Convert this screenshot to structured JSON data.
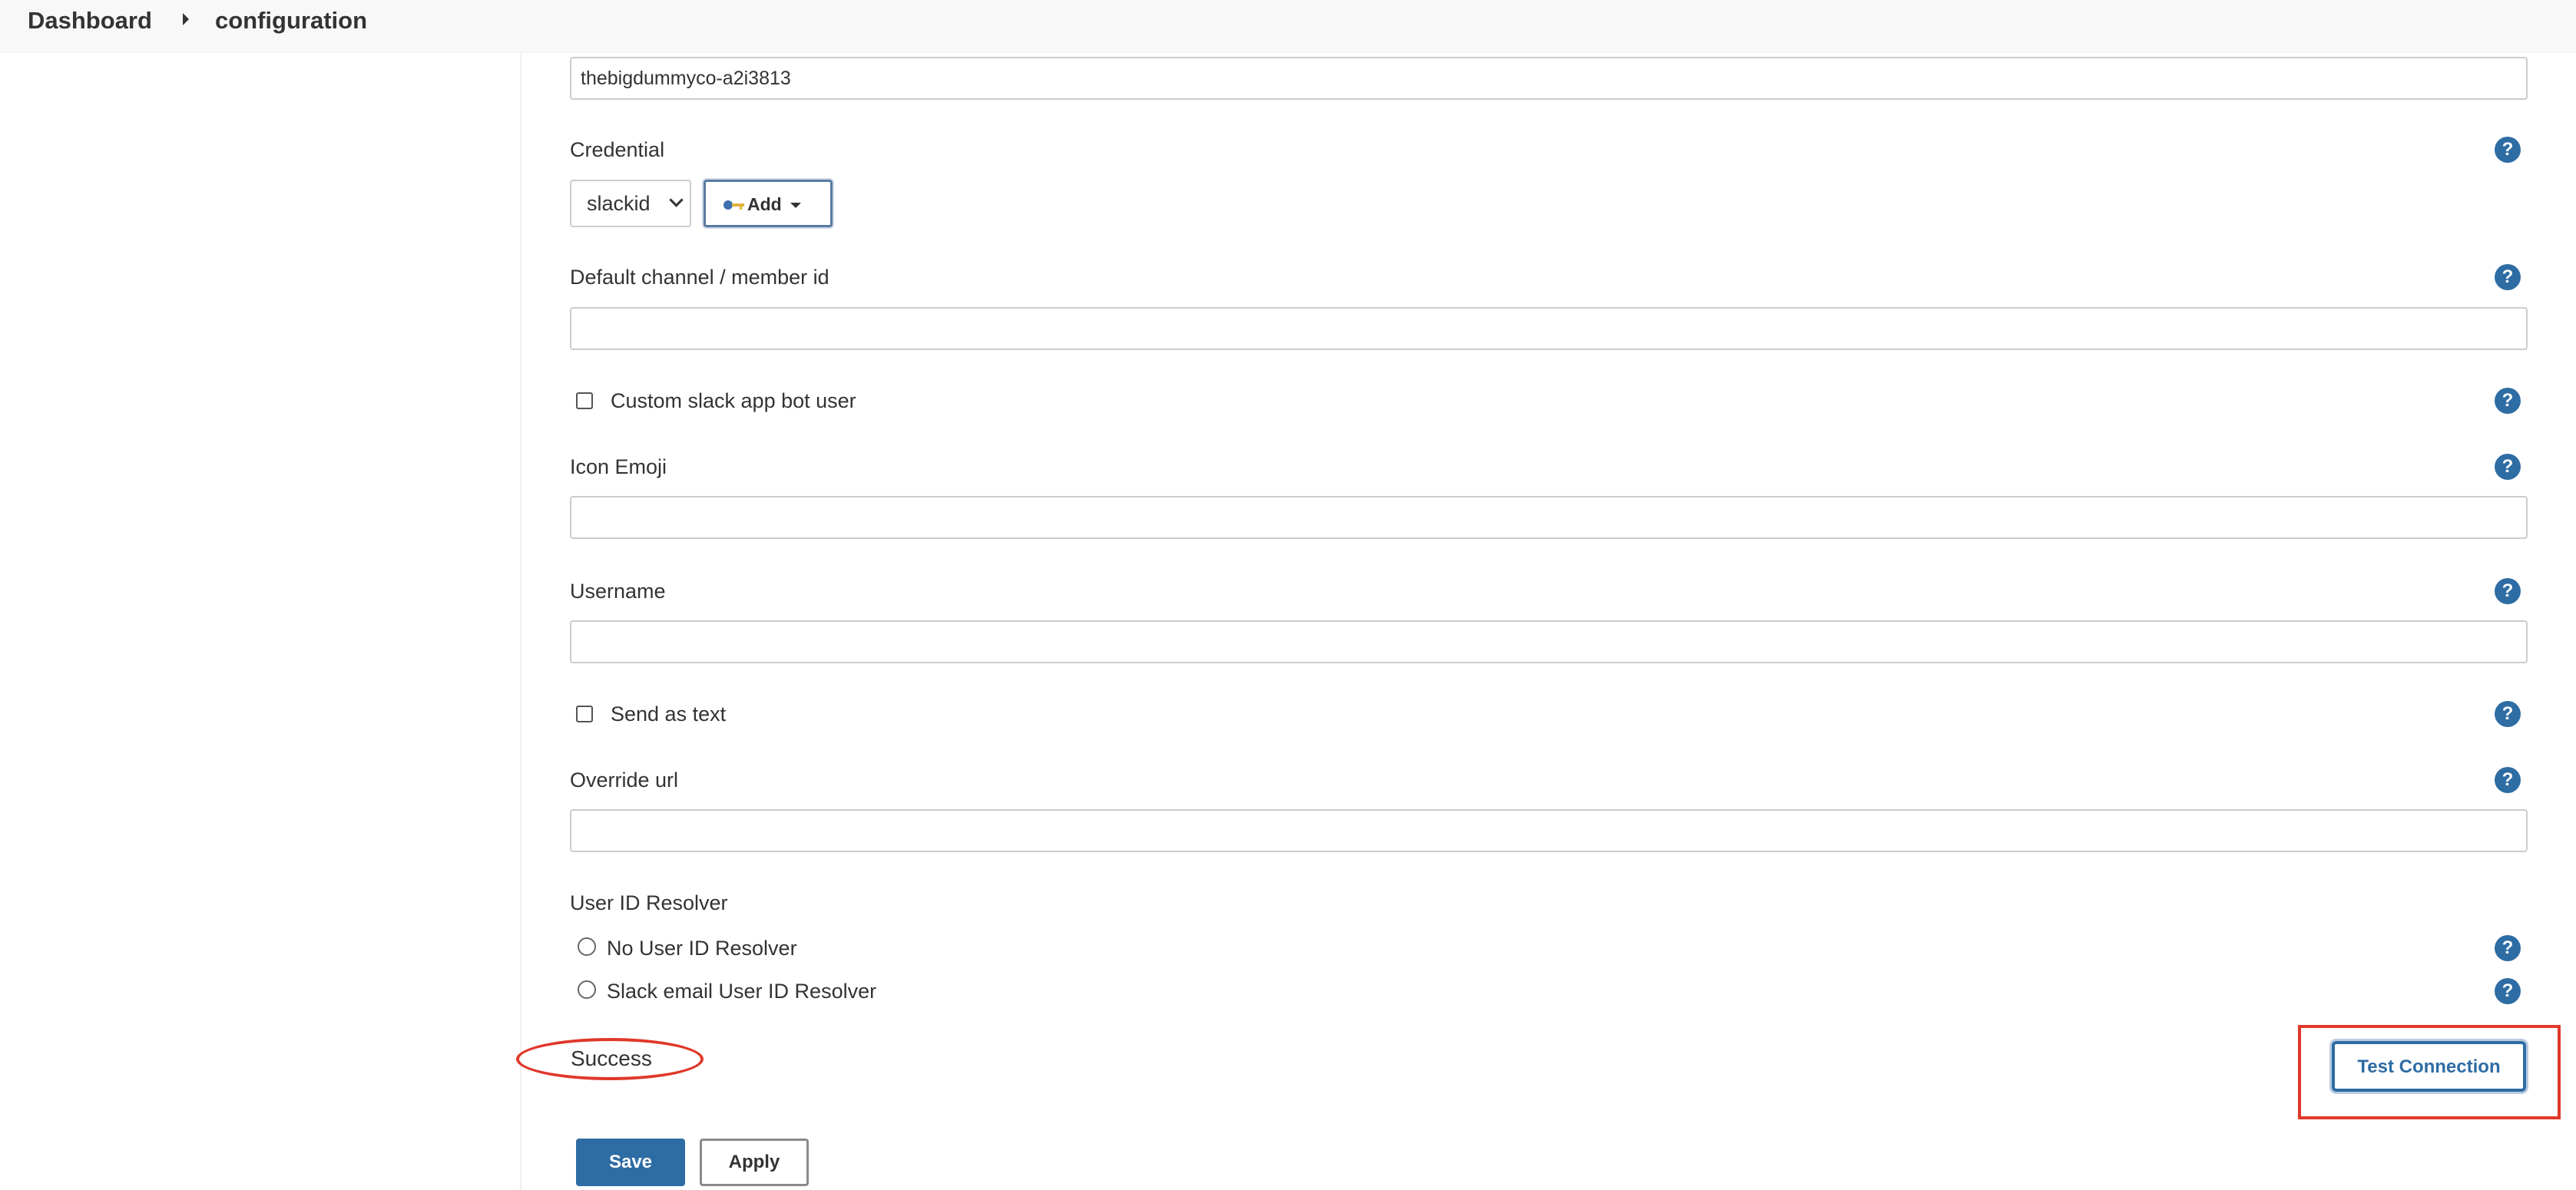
{
  "breadcrumb": {
    "home": "Dashboard",
    "current": "configuration"
  },
  "workspace": {
    "value": "thebigdummyco-a2i3813"
  },
  "credential": {
    "label": "Credential",
    "selected": "slackid",
    "add_label": "Add",
    "add_icon": "key-icon"
  },
  "default_channel": {
    "label": "Default channel / member id",
    "value": ""
  },
  "custom_bot": {
    "label": "Custom slack app bot user",
    "checked": false
  },
  "icon_emoji": {
    "label": "Icon Emoji",
    "value": ""
  },
  "username": {
    "label": "Username",
    "value": ""
  },
  "send_as_text": {
    "label": "Send as text",
    "checked": false
  },
  "override_url": {
    "label": "Override url",
    "value": ""
  },
  "user_id_resolver": {
    "label": "User ID Resolver",
    "options": [
      "No User ID Resolver",
      "Slack email User ID Resolver"
    ]
  },
  "help": {
    "glyph": "?"
  },
  "status": {
    "message": "Success"
  },
  "actions": {
    "test_connection": "Test Connection",
    "save": "Save",
    "apply": "Apply"
  },
  "colors": {
    "primary": "#2e6ca4",
    "annotation": "#e0382a",
    "topbar": "#f8f8f8",
    "border": "#cccccc"
  }
}
